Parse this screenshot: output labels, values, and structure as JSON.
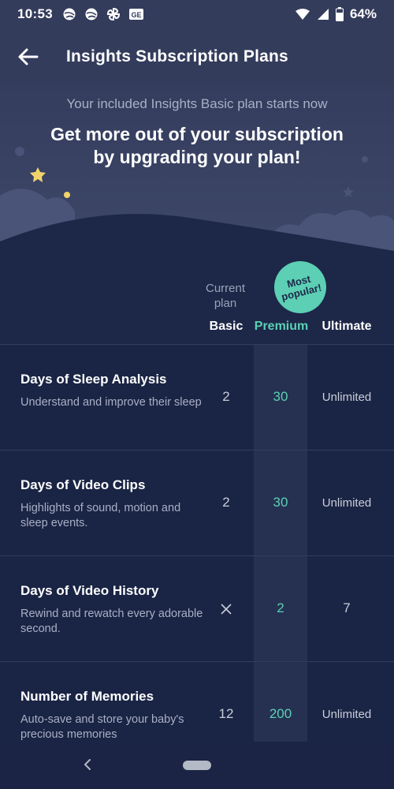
{
  "status_bar": {
    "time": "10:53",
    "battery_percent": "64%",
    "notification_icons": [
      "globe-icon",
      "globe-icon",
      "pinwheel-icon",
      "ge-icon"
    ]
  },
  "app_bar": {
    "title": "Insights Subscription Plans"
  },
  "hero": {
    "subtitle": "Your included Insights Basic plan starts now",
    "headline_line1": "Get more out of your subscription",
    "headline_line2": "by upgrading your plan!"
  },
  "plans": {
    "badge_line1": "Most",
    "badge_line2": "popular!",
    "current_plan_line1": "Current",
    "current_plan_line2": "plan",
    "columns": [
      "Basic",
      "Premium",
      "Ultimate"
    ]
  },
  "rows": [
    {
      "name": "Days of Sleep Analysis",
      "description": "Understand and improve their sleep",
      "basic": "2",
      "premium": "30",
      "ultimate": "Unlimited"
    },
    {
      "name": "Days of Video Clips",
      "description": "Highlights of sound, motion and sleep events.",
      "basic": "2",
      "premium": "30",
      "ultimate": "Unlimited"
    },
    {
      "name": "Days of Video History",
      "description": "Rewind and rewatch every adorable second.",
      "basic": "",
      "premium": "2",
      "ultimate": "7"
    },
    {
      "name": "Number of Memories",
      "description": "Auto-save and store your baby's precious memories",
      "basic": "12",
      "premium": "200",
      "ultimate": "Unlimited"
    }
  ],
  "colors": {
    "accent": "#5ccfb4",
    "background": "#1a2444",
    "header": "#343c5c"
  }
}
